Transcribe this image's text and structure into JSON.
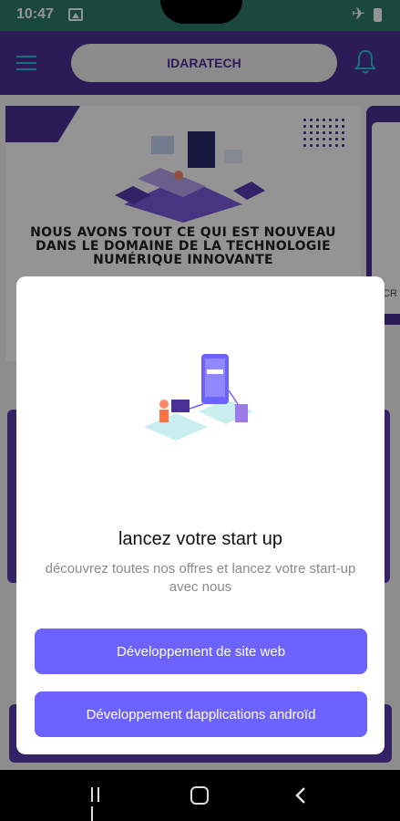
{
  "status_bar": {
    "time": "10:47",
    "icons": [
      "gallery-icon",
      "airplane-icon",
      "battery-icon"
    ]
  },
  "header": {
    "title": "IDARATECH",
    "menu_icon": "menu-icon",
    "bell_icon": "bell-icon"
  },
  "background": {
    "hero_headline": "NOUS AVONS TOUT CE QUI EST NOUVEAU DANS LE DOMAINE DE LA TECHNOLOGIE NUMÉRIQUE INNOVANTE",
    "side_card_text": "CR"
  },
  "modal": {
    "title": "lancez votre start up",
    "description": "découvrez toutes nos offres et lancez votre start-up avec nous",
    "buttons": [
      {
        "label": "Développement de site web"
      },
      {
        "label": "Développement dapplications androïd"
      }
    ]
  },
  "colors": {
    "brand": "#4b2f96",
    "button": "#6c63ff",
    "status_bar": "#2e7d6a",
    "accent": "#26c6da"
  },
  "nav_bar": {
    "icons": [
      "recents-icon",
      "home-icon",
      "back-icon"
    ]
  }
}
